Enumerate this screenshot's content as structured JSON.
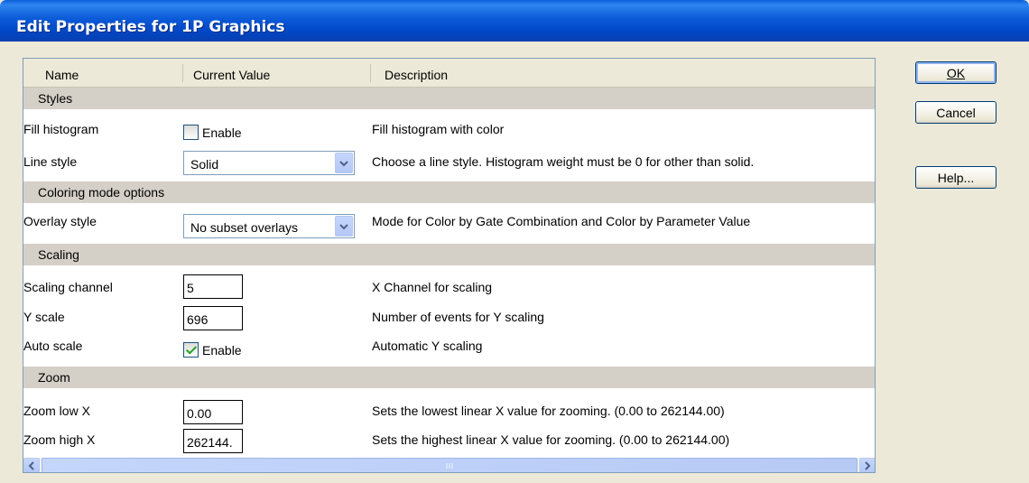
{
  "window": {
    "title": "Edit Properties for 1P Graphics"
  },
  "grid": {
    "columns": {
      "name": "Name",
      "value": "Current Value",
      "description": "Description"
    },
    "sections": {
      "styles": "Styles",
      "coloring": "Coloring mode options",
      "scaling": "Scaling",
      "zoom": "Zoom"
    },
    "rows": {
      "fill_histogram": {
        "name": "Fill histogram",
        "checkbox_label": "Enable",
        "checked": false,
        "description": "Fill histogram with color"
      },
      "line_style": {
        "name": "Line style",
        "value": "Solid",
        "description": "Choose a line style.  Histogram weight must be 0 for other than solid."
      },
      "overlay_style": {
        "name": "Overlay style",
        "value": "No subset overlays",
        "description": "Mode for Color by Gate Combination and Color by Parameter Value"
      },
      "scaling_channel": {
        "name": "Scaling channel",
        "value": "5",
        "description": "X Channel for scaling"
      },
      "y_scale": {
        "name": "Y scale",
        "value": "696",
        "description": "Number of events for Y scaling"
      },
      "auto_scale": {
        "name": "Auto scale",
        "checkbox_label": "Enable",
        "checked": true,
        "description": "Automatic Y scaling"
      },
      "zoom_low_x": {
        "name": "Zoom low X",
        "value": "0.00",
        "description": "Sets the lowest linear X value for zooming. (0.00 to 262144.00)"
      },
      "zoom_high_x": {
        "name": "Zoom high X",
        "value": "262144.",
        "description": "Sets the highest linear X value for zooming. (0.00 to 262144.00)"
      }
    }
  },
  "buttons": {
    "ok": "OK",
    "cancel": "Cancel",
    "help": "Help..."
  }
}
